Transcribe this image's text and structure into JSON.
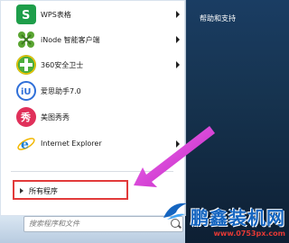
{
  "right_pane": {
    "item": "帮助和支持"
  },
  "programs": [
    {
      "label": "WPS表格",
      "icon": "wps-sheet-icon",
      "color": "#1e9e4a",
      "has_arrow": true
    },
    {
      "label": "iNode 智能客户端",
      "icon": "inode-icon",
      "color": "#5aa532",
      "has_arrow": true
    },
    {
      "label": "360安全卫士",
      "icon": "360-icon",
      "color": "#4cae3c",
      "has_arrow": true
    },
    {
      "label": "爱思助手7.0",
      "icon": "i4-icon",
      "color": "#2f6fd8",
      "has_arrow": false
    },
    {
      "label": "美图秀秀",
      "icon": "meitu-icon",
      "color": "#e0305a",
      "has_arrow": false
    },
    {
      "label": "Internet Explorer",
      "icon": "ie-icon",
      "color": "#1e7fd4",
      "has_arrow": true
    }
  ],
  "all_programs": "所有程序",
  "search": {
    "placeholder": "搜索程序和文件"
  },
  "watermark": {
    "title": "鹏鑫装机网",
    "url": "www.0753px.com"
  },
  "colors": {
    "highlight_box": "#e23a3a",
    "pointer_arrow": "#e040e0"
  }
}
